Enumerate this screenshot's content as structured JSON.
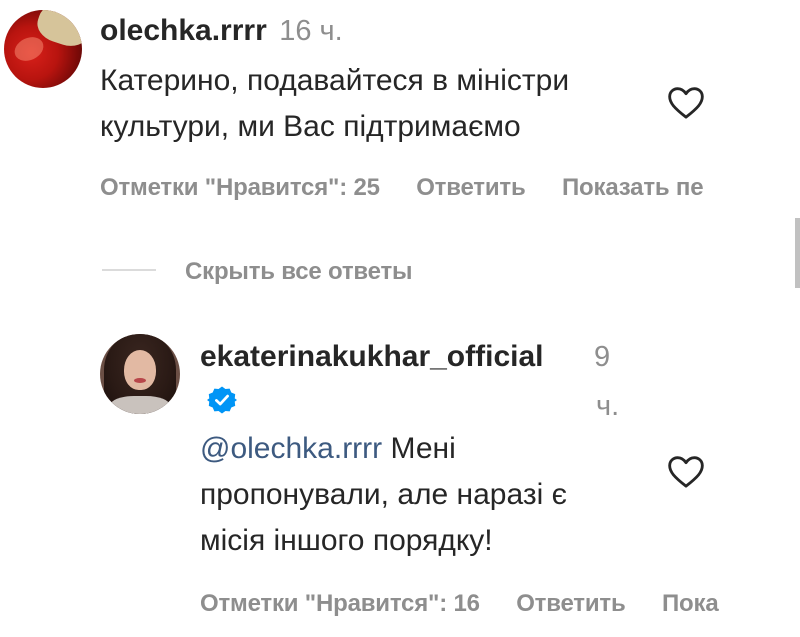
{
  "comments": [
    {
      "username": "olechka.rrrr",
      "timestamp": "16 ч.",
      "text_line1": "Катерино, подавайтеся в міністри",
      "text_line2": "культури, ми Вас підтримаємо",
      "likes_label": "Отметки \"Нравится\": 25",
      "reply_label": "Ответить",
      "translate_label": "Показать пе",
      "avatar_icon": "avatar-red-photo",
      "like_icon": "heart-outline-icon"
    },
    {
      "username": "ekaterinakukhar_official",
      "timestamp_line1": "9",
      "timestamp_line2": "ч.",
      "mention": "@olechka.rrrr",
      "text_line1": " Мені",
      "text_line2": "пропонували, але наразі є",
      "text_line3": "місія іншого порядку!",
      "likes_label": "Отметки \"Нравится\": 16",
      "reply_label": "Ответить",
      "translate_label": "Пока",
      "verified_icon": "verified-badge-icon",
      "avatar_icon": "avatar-woman-photo",
      "like_icon": "heart-outline-icon"
    }
  ],
  "replies_toggle": {
    "label": "Скрыть все ответы"
  },
  "colors": {
    "text_primary": "#262626",
    "text_secondary": "#8e8e8e",
    "link_mention": "#00376b",
    "verified_blue": "#0095f6",
    "divider": "#dbdbdb"
  }
}
